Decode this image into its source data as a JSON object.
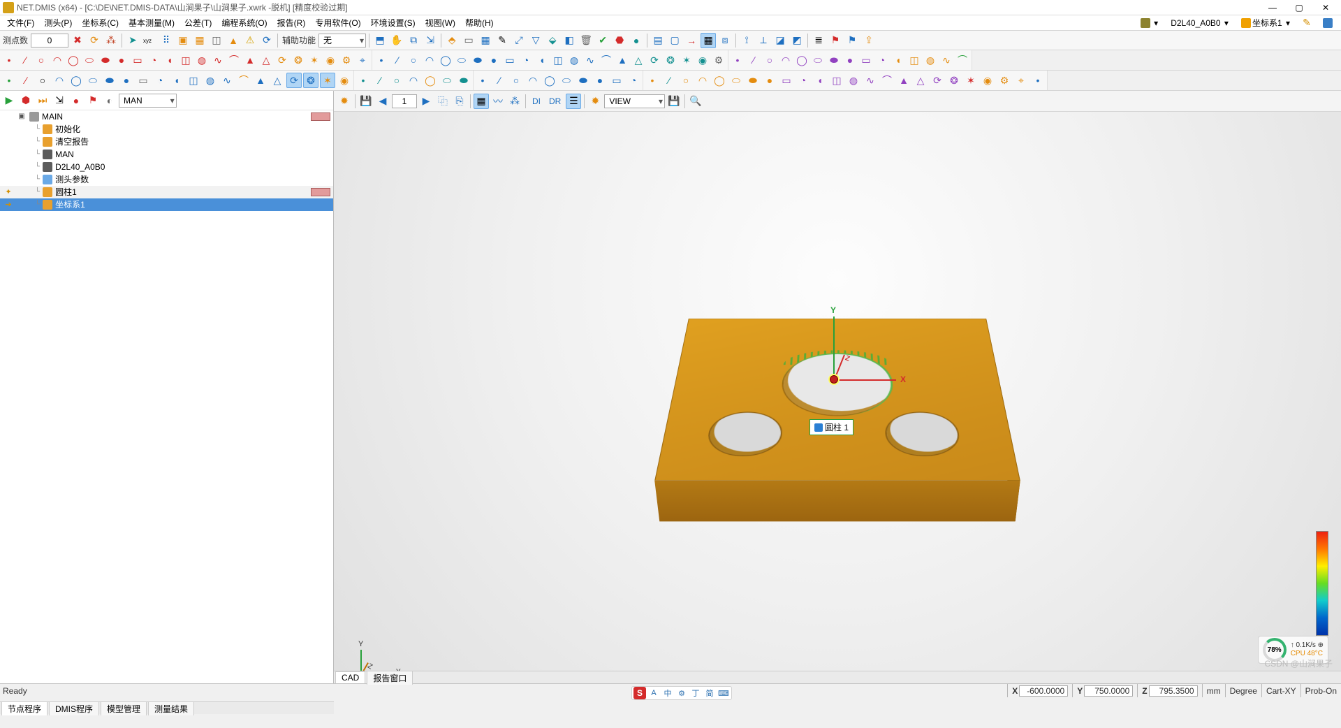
{
  "window": {
    "title": "NET.DMIS (x64) - [C:\\DE\\NET.DMIS-DATA\\山涧果子\\山涧果子.xwrk -脱机] [精度校验过期]",
    "min": "—",
    "max": "▢",
    "close": "✕"
  },
  "menu": {
    "items": [
      "文件(F)",
      "测头(P)",
      "坐标系(C)",
      "基本测量(M)",
      "公差(T)",
      "编程系统(O)",
      "报告(R)",
      "专用软件(O)",
      "环境设置(S)",
      "视图(W)",
      "帮助(H)"
    ],
    "right_items": [
      "D2L40_A0B0",
      "坐标系1"
    ]
  },
  "toolbar1": {
    "label_points": "测点数",
    "points_value": "0",
    "aux_label": "辅助功能",
    "aux_value": "无"
  },
  "icons_row2_groupA": [
    "point",
    "line",
    "circle",
    "arc",
    "ellipse",
    "slot1",
    "slot2",
    "sphere",
    "plane",
    "cone",
    "cylinder",
    "cube",
    "torus",
    "curve",
    "surf-v",
    "prism",
    "triangle",
    "rev",
    "sweep",
    "blob",
    "sphere2",
    "fit",
    "cyl-db"
  ],
  "icons_row2_groupB": [
    "dim-point",
    "dim-line",
    "circle-b",
    "arc-b",
    "ell-b",
    "slot-b",
    "slot2-b",
    "plane-b",
    "rect-b",
    "sphere-b",
    "cyl-b",
    "vee",
    "rev-b",
    "cone-b",
    "bevel",
    "pattern",
    "circ-c",
    "round-c",
    "ring-c",
    "ring2-c",
    "ell-r",
    "cross"
  ],
  "icons_row2_groupC": [
    "dim-pt",
    "dim-ln",
    "circ",
    "arc-c",
    "slot-c",
    "slot-d",
    "slot-e",
    "rect-c",
    "sph-c",
    "cyl-c",
    "cone-c",
    "tri-c",
    "pyr-c",
    "blade",
    "shell"
  ],
  "icons_row3_groupA": [
    "init",
    "prog-1",
    "prog-2",
    "cs-1",
    "cs-2",
    "cs-3",
    "cs-4",
    "cs-5",
    "rps",
    "cs-6",
    "cs-7",
    "cs-8",
    "cs-9",
    "cs-10",
    "cs-11",
    "cs-12",
    "cs-13",
    "cs-14",
    "cs-15",
    "cs-16",
    "cs-17"
  ],
  "icons_row3_groupB": [
    "cyl-t",
    "db-t",
    "drum",
    "cyl2",
    "grp",
    "body",
    "cap"
  ],
  "icons_row3_groupC": [
    "shell1",
    "shell2",
    "shell3",
    "shell4",
    "shell5",
    "shell6",
    "shell7",
    "shell8",
    "shell9",
    "shell10"
  ],
  "icons_row3_groupD": [
    "ln-1",
    "lns",
    "rect-d",
    "ang",
    "par",
    "dist",
    "line-d",
    "intx",
    "circ-d",
    "perp",
    "angle-t",
    "conc1",
    "conc2",
    "sym",
    "prof1",
    "runout",
    "pos",
    "plus",
    "diam",
    "arrow",
    "label",
    "dim-label",
    "chart",
    "NT"
  ],
  "mode_bar": {
    "combo": "MAN"
  },
  "tree": {
    "root": "MAIN",
    "items": [
      {
        "label": "初始化",
        "icon": "orange"
      },
      {
        "label": "清空报告",
        "icon": "orange"
      },
      {
        "label": "MAN",
        "icon": "dark"
      },
      {
        "label": "D2L40_A0B0",
        "icon": "dark"
      },
      {
        "label": "测头参数",
        "icon": "blue"
      },
      {
        "label": "圆柱1",
        "icon": "orange",
        "stripe": true
      },
      {
        "label": "坐标系1",
        "icon": "orange",
        "selected": true
      }
    ]
  },
  "view_toolbar": {
    "spin_value": "1",
    "view_label": "VIEW"
  },
  "feature_label": "圆柱 1",
  "perf": {
    "percent": "78%",
    "rate": "0.1K/s",
    "temp": "CPU 48°C"
  },
  "watermark": "CSDN @山涧果子",
  "bottom_tabs_left": [
    "节点程序",
    "DMIS程序",
    "模型管理",
    "测量结果"
  ],
  "bottom_tabs_right": [
    "CAD",
    "报告窗口"
  ],
  "ime_icons": [
    "S",
    "A",
    "中",
    "⚙",
    "丁",
    "简",
    "⌨"
  ],
  "status": {
    "ready": "Ready",
    "x_label": "X",
    "x_val": "-600.0000",
    "y_label": "Y",
    "y_val": "750.0000",
    "z_label": "Z",
    "z_val": "795.3500",
    "unit1": "mm",
    "unit2": "Degree",
    "unit3": "Cart-XY",
    "unit4": "Prob-On"
  }
}
